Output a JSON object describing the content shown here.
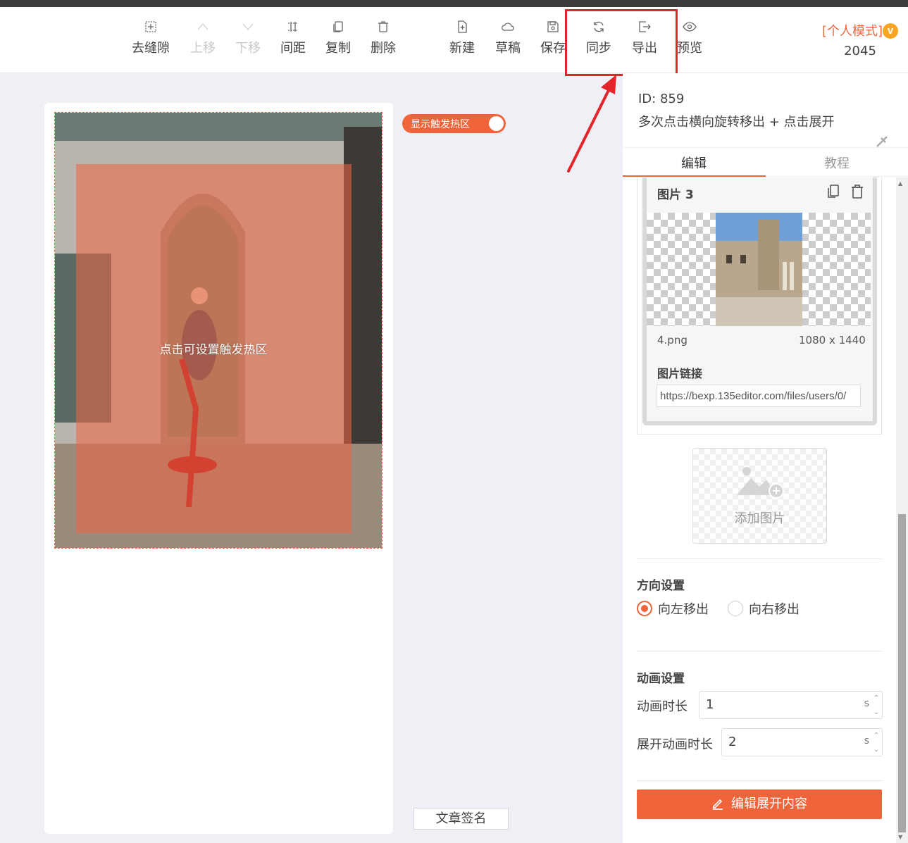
{
  "toolbar": {
    "items": [
      {
        "label": "去缝隙",
        "icon": "grid-dots-icon",
        "disabled": false
      },
      {
        "label": "上移",
        "icon": "chevron-up-icon",
        "disabled": true
      },
      {
        "label": "下移",
        "icon": "chevron-down-icon",
        "disabled": true
      },
      {
        "label": "间距",
        "icon": "spacing-icon",
        "disabled": false
      },
      {
        "label": "复制",
        "icon": "copy-icon",
        "disabled": false
      },
      {
        "label": "删除",
        "icon": "trash-icon",
        "disabled": false
      },
      {
        "label": "新建",
        "icon": "new-file-icon",
        "disabled": false
      },
      {
        "label": "草稿",
        "icon": "cloud-icon",
        "disabled": false
      },
      {
        "label": "保存",
        "icon": "save-icon",
        "disabled": false
      },
      {
        "label": "同步",
        "icon": "sync-icon",
        "disabled": false
      },
      {
        "label": "导出",
        "icon": "export-icon",
        "disabled": false
      },
      {
        "label": "预览",
        "icon": "eye-icon",
        "disabled": false
      }
    ],
    "mode_label": "[个人模式]",
    "mode_badge": "v",
    "mode_number": "2045"
  },
  "canvas": {
    "hotspot_toggle_label": "显示触发热区",
    "hotspot_hint": "点击可设置触发热区",
    "signature_button": "文章签名"
  },
  "panel": {
    "id_text": "ID: 859",
    "name": "多次点击横向旋转移出 + 点击展开",
    "tabs": [
      "编辑",
      "教程"
    ],
    "image_card": {
      "title": "图片 3",
      "file_name": "4.png",
      "dimensions": "1080 x 1440",
      "link_label": "图片链接",
      "link_value": "https://bexp.135editor.com/files/users/0/"
    },
    "add_image_label": "添加图片",
    "direction": {
      "title": "方向设置",
      "options": [
        "向左移出",
        "向右移出"
      ],
      "selected": "向左移出"
    },
    "animation": {
      "title": "动画设置",
      "duration_label": "动画时长",
      "duration_value": "1",
      "expand_label": "展开动画时长",
      "expand_value": "2",
      "unit": "s"
    },
    "edit_button": "编辑展开内容"
  },
  "colors": {
    "accent": "#f0643c",
    "highlight": "#e3242b"
  }
}
